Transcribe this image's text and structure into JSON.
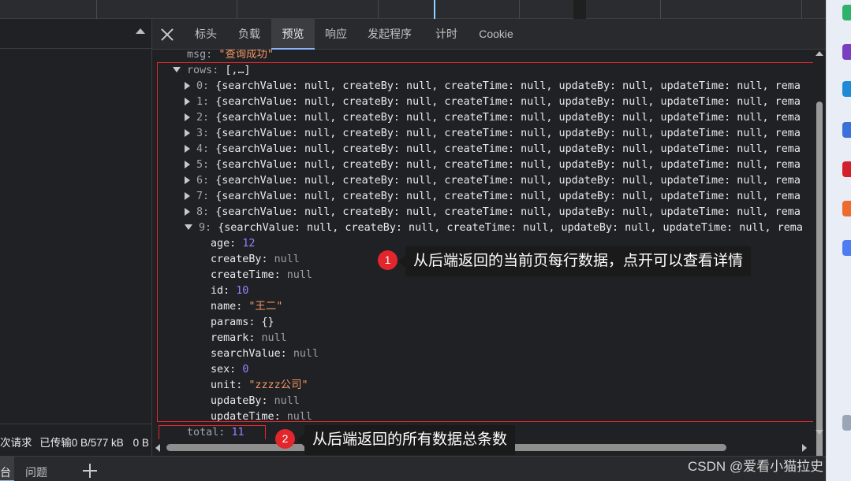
{
  "tabs": [
    {
      "label": "标头",
      "active": false
    },
    {
      "label": "负载",
      "active": false
    },
    {
      "label": "预览",
      "active": true
    },
    {
      "label": "响应",
      "active": false
    },
    {
      "label": "发起程序",
      "active": false
    },
    {
      "label": "计时",
      "active": false
    },
    {
      "label": "Cookie",
      "active": false
    }
  ],
  "status_bar": {
    "requests": "次请求",
    "transferred": "已传输0 B/577 kB",
    "resources": "0 B"
  },
  "preview": {
    "msg_key": "msg:",
    "msg_value": "\"查询成功\"",
    "rows_key": "rows:",
    "rows_summary": "[,…]",
    "row_summary": "{searchValue: null, createBy: null, createTime: null, updateBy: null, updateTime: null, rema",
    "collapsed_rows": [
      "0:",
      "1:",
      "2:",
      "3:",
      "4:",
      "5:",
      "6:",
      "7:",
      "8:"
    ],
    "expanded_row_index": "9:",
    "fields": [
      {
        "key": "age:",
        "value": "12",
        "type": "num"
      },
      {
        "key": "createBy:",
        "value": "null",
        "type": "nul"
      },
      {
        "key": "createTime:",
        "value": "null",
        "type": "nul"
      },
      {
        "key": "id:",
        "value": "10",
        "type": "num"
      },
      {
        "key": "name:",
        "value": "\"王二\"",
        "type": "str"
      },
      {
        "key": "params:",
        "value": "{}",
        "type": "key"
      },
      {
        "key": "remark:",
        "value": "null",
        "type": "nul"
      },
      {
        "key": "searchValue:",
        "value": "null",
        "type": "nul"
      },
      {
        "key": "sex:",
        "value": "0",
        "type": "num"
      },
      {
        "key": "unit:",
        "value": "\"zzzz公司\"",
        "type": "str"
      },
      {
        "key": "updateBy:",
        "value": "null",
        "type": "nul"
      },
      {
        "key": "updateTime:",
        "value": "null",
        "type": "nul"
      }
    ],
    "total_key": "total:",
    "total_value": "11"
  },
  "annotations": [
    {
      "badge": "1",
      "text": "从后端返回的当前页每行数据，点开可以查看详情"
    },
    {
      "badge": "2",
      "text": "从后端返回的所有数据总条数"
    }
  ],
  "drawer": {
    "console_tab_cut": "台",
    "issues_tab": "问题"
  },
  "watermark": "CSDN @爱看小猫拉史",
  "colors": {
    "annotation_red": "#e2272c",
    "string": "#f29766",
    "number": "#9980ff",
    "active_tab_underline": "#8ab4f8"
  }
}
